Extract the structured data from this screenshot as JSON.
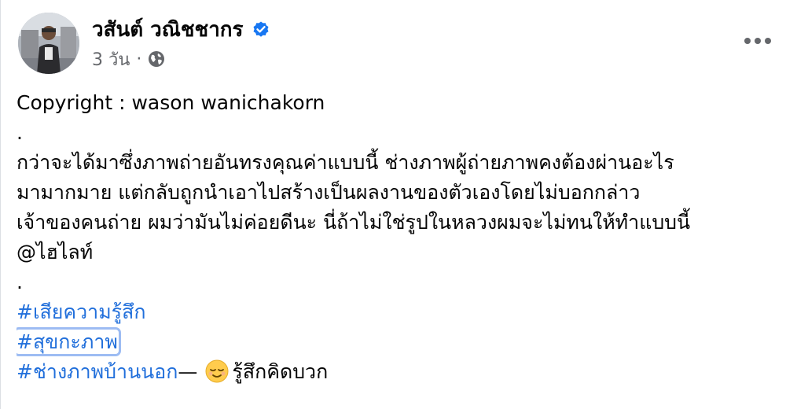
{
  "post": {
    "author_name": "วสันต์ วณิชชากร",
    "verified_icon": "verified-badge-icon",
    "timestamp": "3 วัน",
    "separator": "·",
    "audience_icon": "globe-icon",
    "more_icon": "more-options-icon"
  },
  "content": {
    "copyright": "Copyright : wason wanichakorn",
    "dot1": ".",
    "paragraph_lines": [
      "กว่าจะได้มาซึ่งภาพถ่ายอันทรงคุณค่าแบบนี้ ช่างภาพผู้ถ่ายภาพคงต้องผ่านอะไร",
      "มามากมาย แต่กลับถูกนำเอาไปสร้างเป็นผลงานของตัวเองโดยไม่บอกกล่าว",
      "เจ้าของคนถ่าย ผมว่ามันไม่ค่อยดีนะ  นี่ถ้าไม่ใช่รูปในหลวงผมจะไม่ทนให้ทำแบบนี้",
      "@ไฮไลท์"
    ],
    "dot2": ".",
    "hashtags": [
      "#เสียความรู้สึก",
      "#สุขกะภาพ",
      "#ช่างภาพบ้านนอก"
    ],
    "feeling_dash": "—",
    "feeling_icon": "relieved-face-emoji",
    "feeling_text": "รู้สึกคิดบวก"
  },
  "colors": {
    "link": "#216fdb",
    "secondary_text": "#65676b",
    "verified": "#1877f2"
  }
}
